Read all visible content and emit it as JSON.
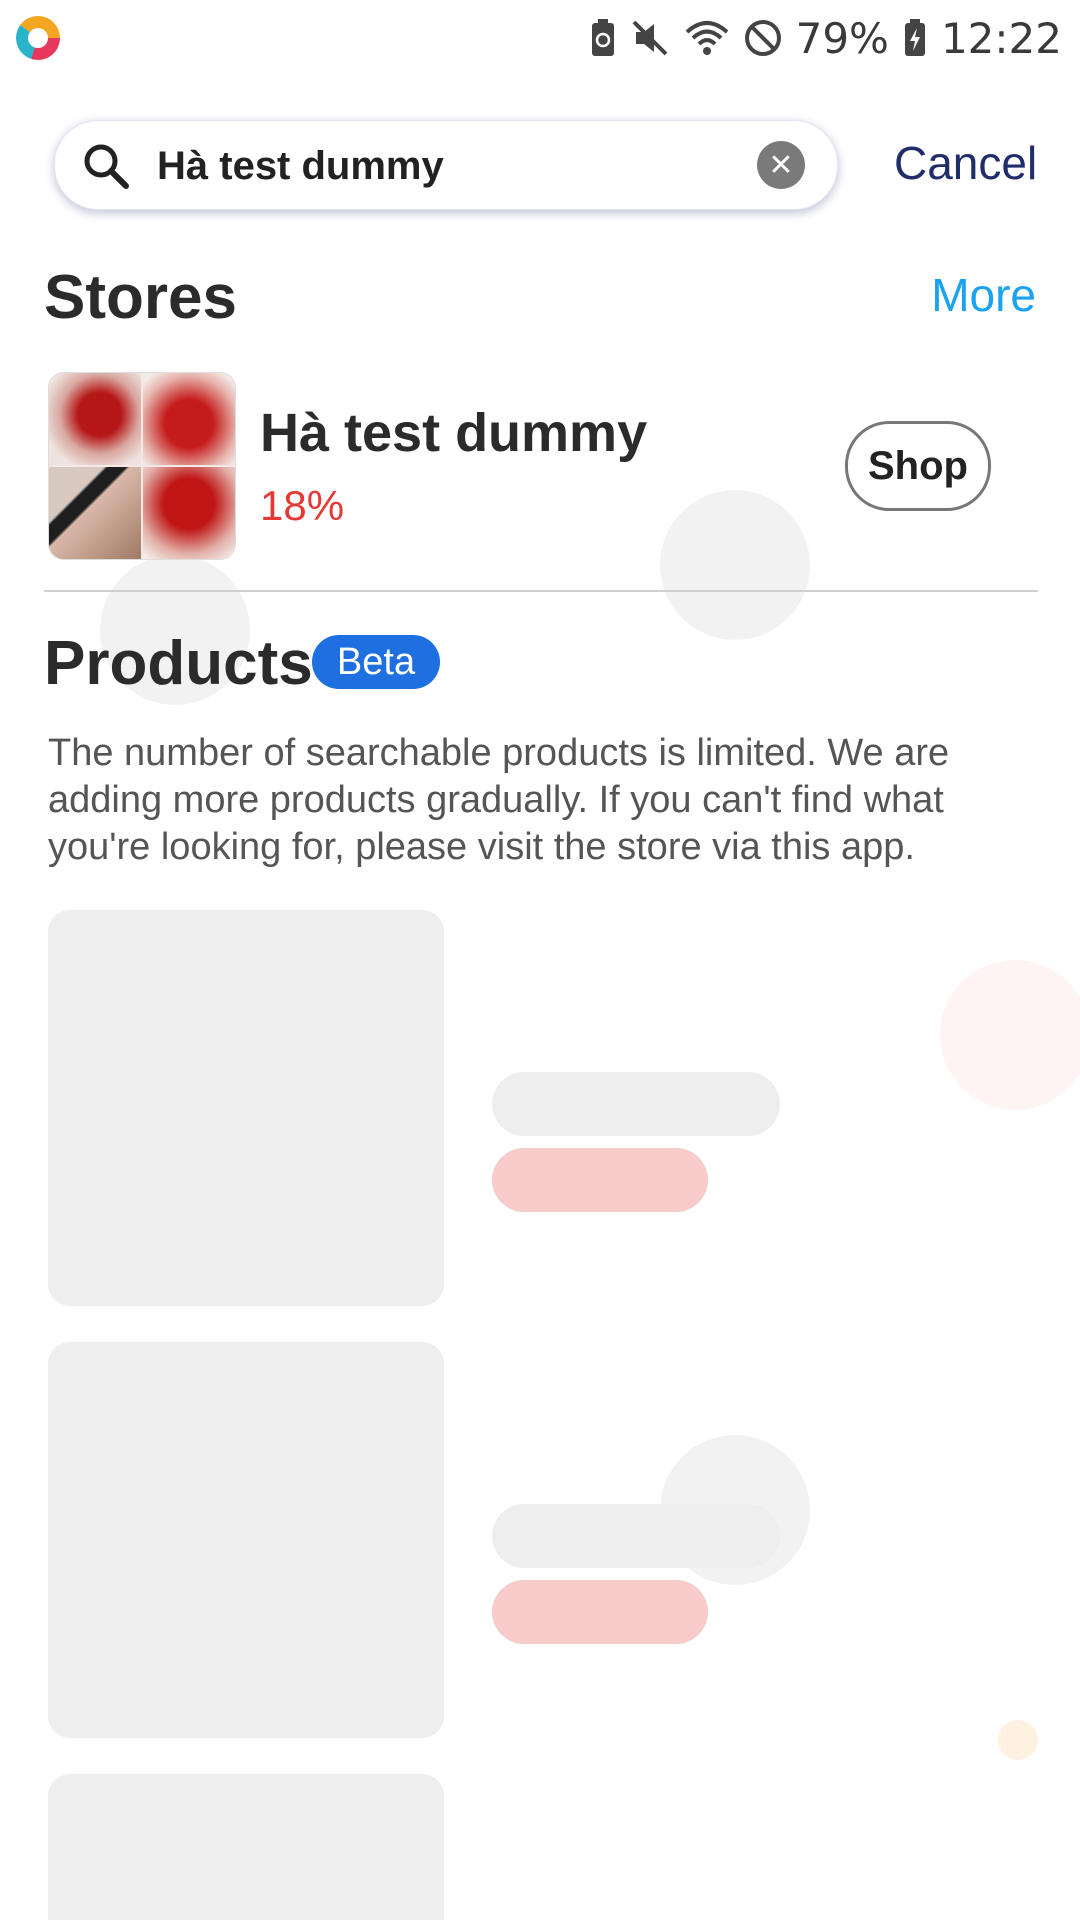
{
  "status_bar": {
    "battery_percent": "79%",
    "time": "12:22"
  },
  "search": {
    "query": "Hà test dummy",
    "cancel_label": "Cancel"
  },
  "stores": {
    "title": "Stores",
    "more_label": "More",
    "items": [
      {
        "name": "Hà test dummy",
        "rate": "18%",
        "shop_label": "Shop"
      }
    ]
  },
  "products": {
    "title": "Products",
    "badge": "Beta",
    "notice": "The number of searchable products is limited. We are adding more products gradually. If you can't find what you're looking for, please visit the store via this app."
  },
  "colors": {
    "accent_link": "#1aa3f0",
    "cancel_text": "#1f2d6b",
    "rate_red": "#e53935",
    "beta_blue": "#1e6fe0",
    "skeleton_grey": "#eeeeee",
    "skeleton_pink": "#f9caca"
  }
}
